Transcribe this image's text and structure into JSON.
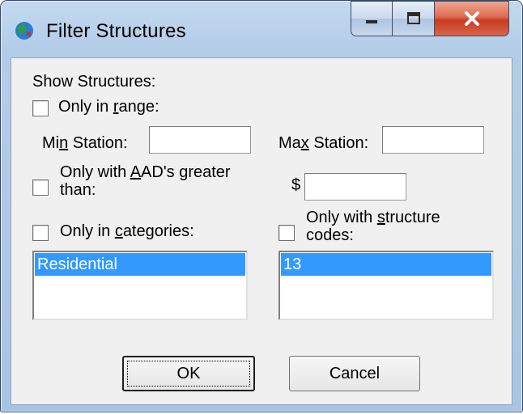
{
  "window": {
    "title": "Filter Structures",
    "icon": "globe-icon"
  },
  "title_controls": {
    "minimize": "minimize-icon",
    "maximize": "maximize-icon",
    "close": "close-icon"
  },
  "form": {
    "section_label": "Show Structures:",
    "range": {
      "checkbox_label_pre": "Only in ",
      "checkbox_label_key": "r",
      "checkbox_label_post": "ange:",
      "checked": false,
      "min_label_pre": "Mi",
      "min_label_key": "n",
      "min_label_post": " Station:",
      "min_value": "",
      "max_label_pre": "Ma",
      "max_label_key": "x",
      "max_label_post": " Station:",
      "max_value": ""
    },
    "aad": {
      "checkbox_label_pre": "Only with ",
      "checkbox_label_key": "A",
      "checkbox_label_post": "AD's greater than:",
      "checked": false,
      "currency_symbol": "$",
      "value": ""
    },
    "categories": {
      "checkbox_label_pre": "Only in ",
      "checkbox_label_key": "c",
      "checkbox_label_post": "ategories:",
      "checked": false,
      "items": [
        "Residential"
      ]
    },
    "structure_codes": {
      "checkbox_label_pre": "Only with ",
      "checkbox_label_key": "s",
      "checkbox_label_post": "tructure codes:",
      "checked": false,
      "items": [
        "13"
      ]
    }
  },
  "buttons": {
    "ok": "OK",
    "cancel": "Cancel"
  },
  "colors": {
    "selection": "#3399ff",
    "dialog_bg": "#f0f0f0",
    "frame": "#b3cce8",
    "close_button": "#c73b21"
  }
}
